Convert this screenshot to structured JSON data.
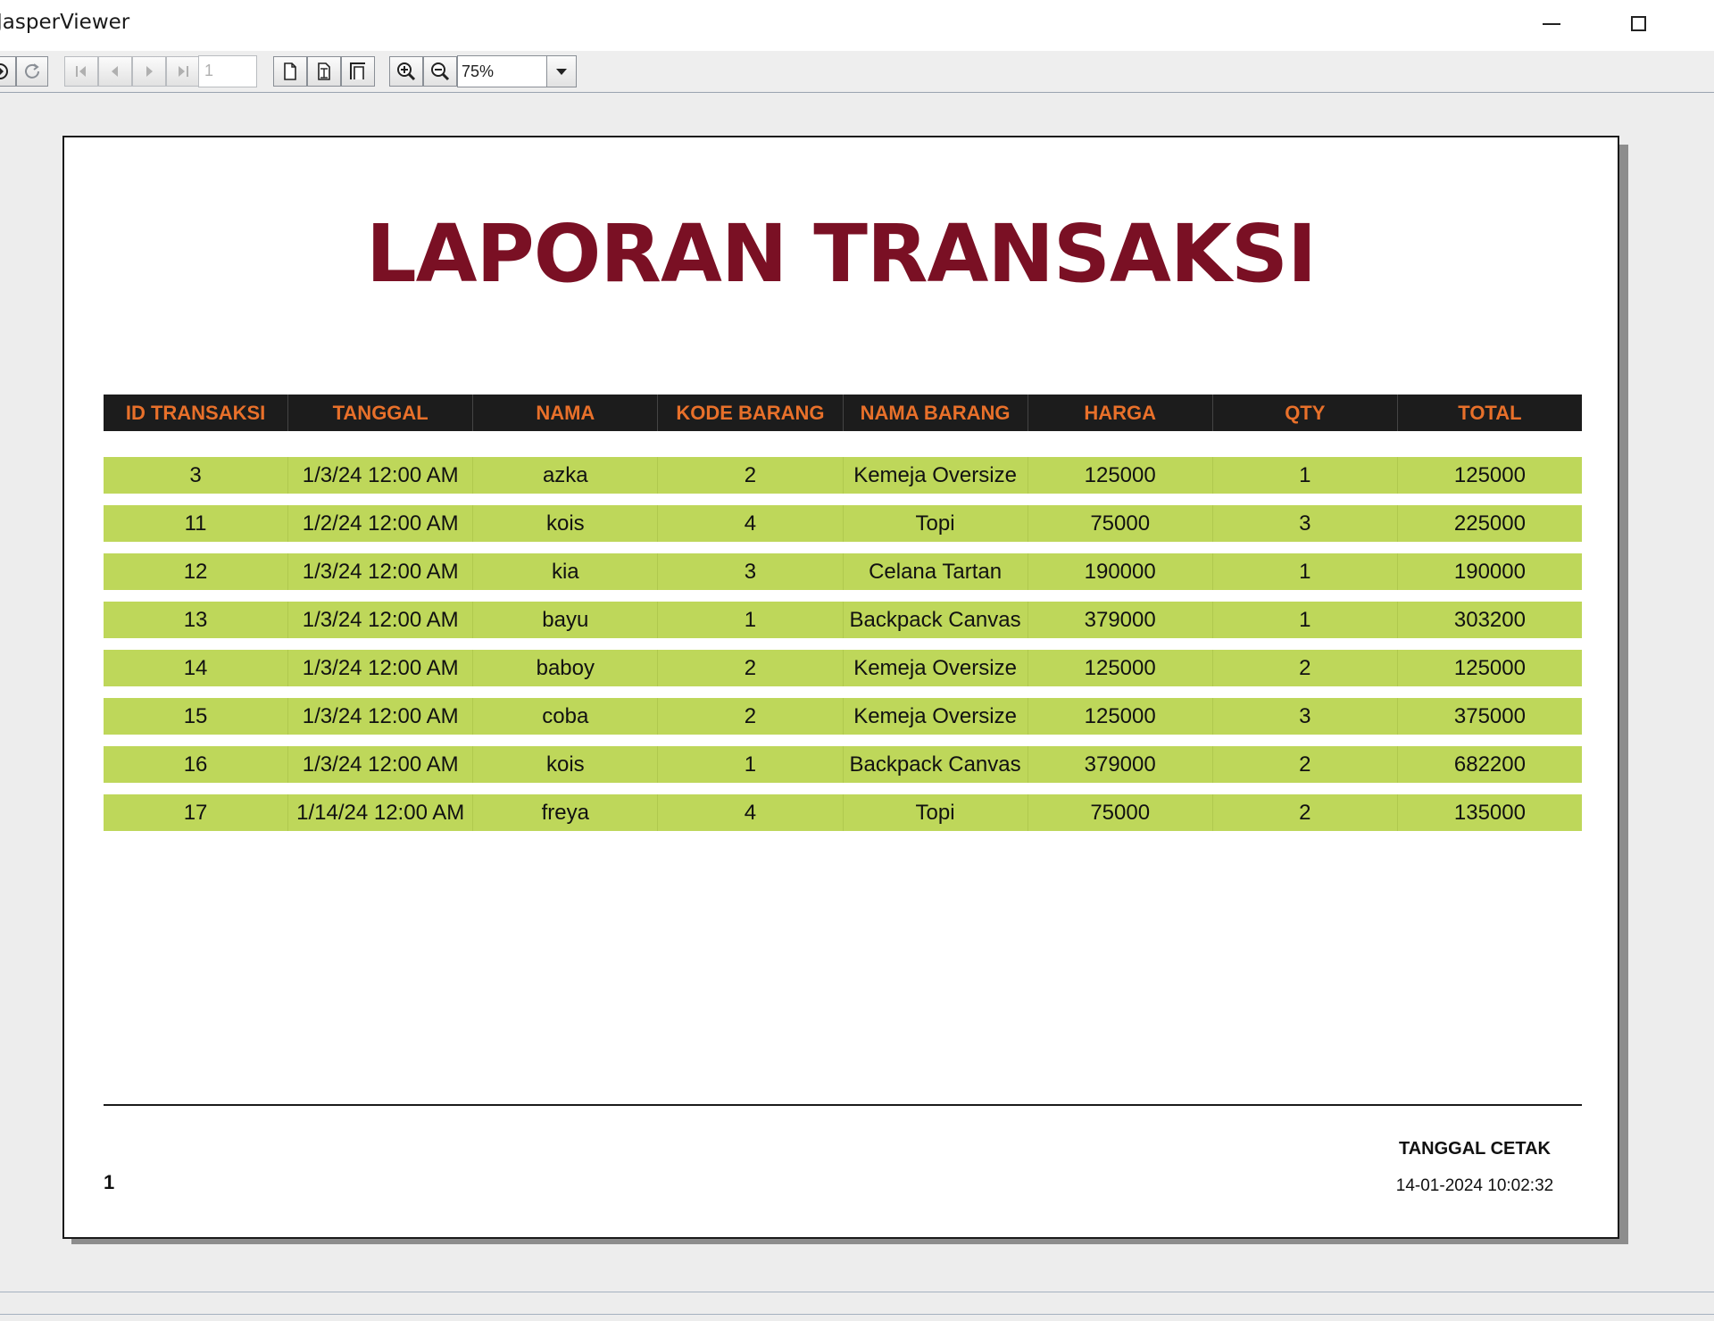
{
  "window": {
    "title": "JasperViewer"
  },
  "toolbar": {
    "page_number": "1",
    "zoom": "75%",
    "icons": [
      "reload-icon",
      "first-page-icon",
      "previous-page-icon",
      "next-page-icon",
      "last-page-icon",
      "actual-size-icon",
      "fit-page-icon",
      "fit-width-icon",
      "zoom-in-icon",
      "zoom-out-icon",
      "dropdown-arrow-icon"
    ]
  },
  "report": {
    "title": "LAPORAN TRANSAKSI",
    "columns": [
      "ID TRANSAKSI",
      "TANGGAL",
      "NAMA",
      "KODE BARANG",
      "NAMA BARANG",
      "HARGA",
      "QTY",
      "TOTAL"
    ],
    "rows": [
      [
        "3",
        "1/3/24 12:00 AM",
        "azka",
        "2",
        "Kemeja Oversize",
        "125000",
        "1",
        "125000"
      ],
      [
        "11",
        "1/2/24 12:00 AM",
        "kois",
        "4",
        "Topi",
        "75000",
        "3",
        "225000"
      ],
      [
        "12",
        "1/3/24 12:00 AM",
        "kia",
        "3",
        "Celana Tartan",
        "190000",
        "1",
        "190000"
      ],
      [
        "13",
        "1/3/24 12:00 AM",
        "bayu",
        "1",
        "Backpack Canvas",
        "379000",
        "1",
        "303200"
      ],
      [
        "14",
        "1/3/24 12:00 AM",
        "baboy",
        "2",
        "Kemeja Oversize",
        "125000",
        "2",
        "125000"
      ],
      [
        "15",
        "1/3/24 12:00 AM",
        "coba",
        "2",
        "Kemeja Oversize",
        "125000",
        "3",
        "375000"
      ],
      [
        "16",
        "1/3/24 12:00 AM",
        "kois",
        "1",
        "Backpack Canvas",
        "379000",
        "2",
        "682200"
      ],
      [
        "17",
        "1/14/24 12:00 AM",
        "freya",
        "4",
        "Topi",
        "75000",
        "2",
        "135000"
      ]
    ],
    "footer": {
      "page_number": "1",
      "print_label": "TANGGAL CETAK",
      "print_date": "14-01-2024 10:02:32"
    }
  },
  "colors": {
    "title": "#7a1024",
    "header_bg": "#1c1c1c",
    "header_text": "#e8702a",
    "row_bg": "#bed75a"
  }
}
